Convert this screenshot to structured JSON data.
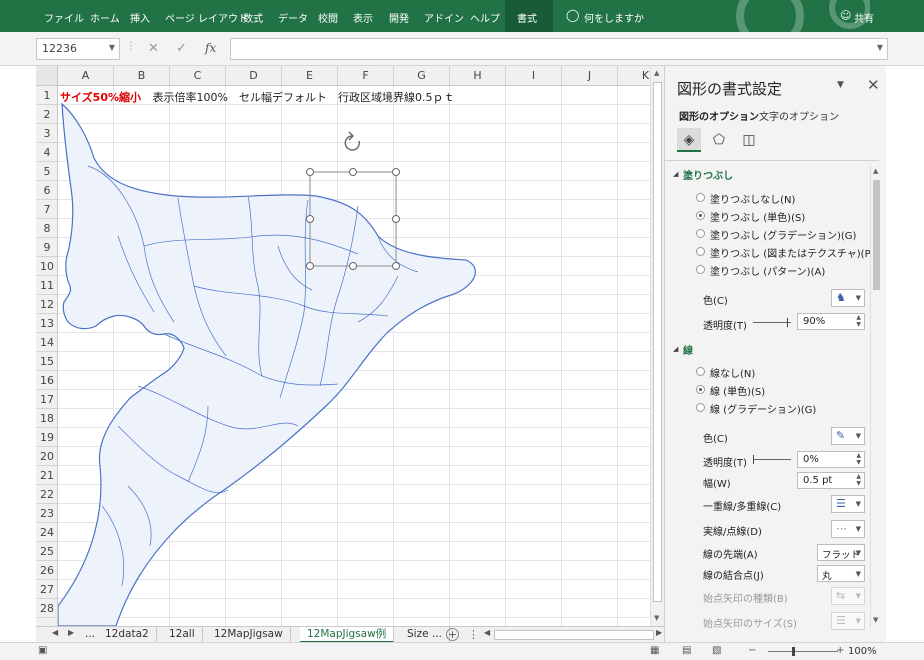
{
  "ribbon": {
    "tabs": [
      "ファイル",
      "ホーム",
      "挿入",
      "ページ レイアウト",
      "数式",
      "データ",
      "校閲",
      "表示",
      "開発",
      "アドイン",
      "ヘルプ",
      "書式"
    ],
    "tell_me": "何をしますか",
    "share": "共有",
    "accent": "#217346"
  },
  "formula_bar": {
    "name_box": "12236",
    "fx": "fx",
    "formula": ""
  },
  "columns": [
    "A",
    "B",
    "C",
    "D",
    "E",
    "F",
    "G",
    "H",
    "I",
    "J",
    "K"
  ],
  "rows": [
    "1",
    "2",
    "3",
    "4",
    "5",
    "6",
    "7",
    "8",
    "9",
    "10",
    "11",
    "12",
    "13",
    "14",
    "15",
    "16",
    "17",
    "18",
    "19",
    "20",
    "21",
    "22",
    "23",
    "24",
    "25",
    "26",
    "27",
    "28"
  ],
  "cell_a1": {
    "red": "サイズ50%縮小",
    "rest": "表示倍率100%　セル幅デフォルト　行政区域境界線0.5ｐｔ"
  },
  "sheet_tabs": {
    "more": "...",
    "tabs": [
      "12data2",
      "12all",
      "12MapJigsaw",
      "12MapJigsaw例",
      "Size ..."
    ],
    "active": "12MapJigsaw例"
  },
  "status": {
    "zoom": "100%"
  },
  "pane": {
    "title": "図形の書式設定",
    "tab_shape": "図形のオプション",
    "tab_text": "文字のオプション",
    "fill": {
      "header": "塗りつぶし",
      "options": [
        "塗りつぶしなし(N)",
        "塗りつぶし (単色)(S)",
        "塗りつぶし (グラデーション)(G)",
        "塗りつぶし (図またはテクスチャ)(P)",
        "塗りつぶし (パターン)(A)"
      ],
      "selected": 1,
      "color_label": "色(C)",
      "transparency_label": "透明度(T)",
      "transparency": "90%",
      "transparency_value": 0.9
    },
    "line": {
      "header": "線",
      "options": [
        "線なし(N)",
        "線 (単色)(S)",
        "線 (グラデーション)(G)"
      ],
      "selected": 1,
      "color_label": "色(C)",
      "transparency_label": "透明度(T)",
      "transparency": "0%",
      "transparency_value": 0.0,
      "width_label": "幅(W)",
      "width": "0.5 pt",
      "compound_label": "一重線/多重線(C)",
      "dash_label": "実線/点線(D)",
      "cap_label": "線の先端(A)",
      "cap": "フラット",
      "join_label": "線の結合点(J)",
      "join": "丸",
      "begin_type_label": "始点矢印の種類(B)",
      "begin_size_label": "始点矢印のサイズ(S)"
    }
  },
  "map": {
    "fill": "#eef3fb",
    "stroke": "#4a72c8"
  }
}
